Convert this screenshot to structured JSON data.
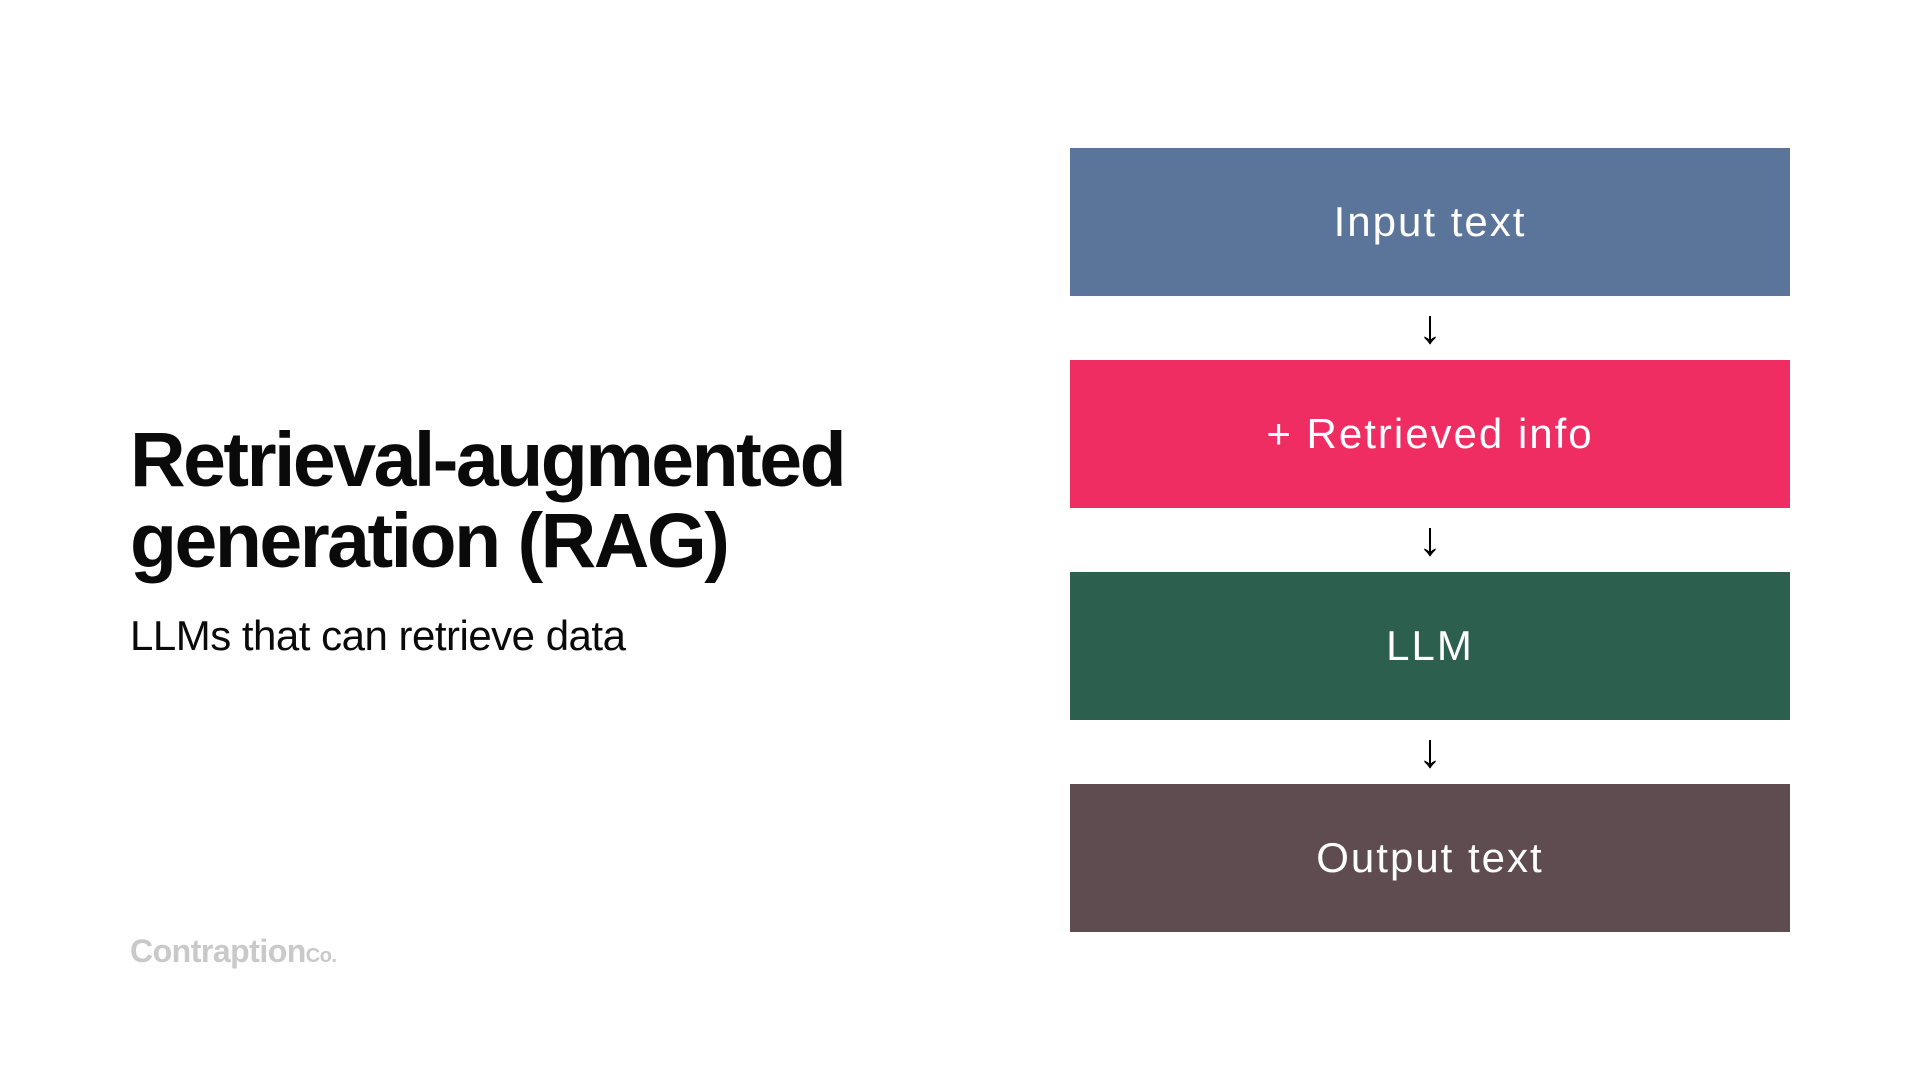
{
  "header": {
    "title_line1": "Retrieval-augmented",
    "title_line2": "generation (RAG)",
    "subtitle": "LLMs that can retrieve data"
  },
  "flow": {
    "steps": [
      {
        "label": "Input text",
        "color": "#5a7599"
      },
      {
        "label": "+ Retrieved info",
        "color": "#ef2d63"
      },
      {
        "label": "LLM",
        "color": "#2d5f4e"
      },
      {
        "label": "Output text",
        "color": "#5f4c51"
      }
    ]
  },
  "brand": {
    "name": "Contraption",
    "suffix": "Co."
  },
  "colors": {
    "box_input": "#5a7599",
    "box_retrieved": "#ef2d63",
    "box_llm": "#2d5f4e",
    "box_output": "#5f4c51",
    "text_primary": "#0a0a0a",
    "brand_gray": "#c9c9c9"
  }
}
